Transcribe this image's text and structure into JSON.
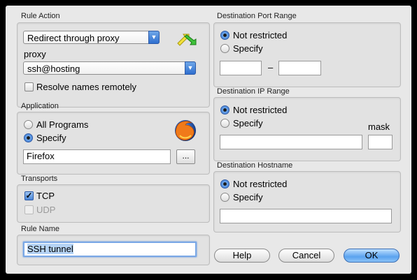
{
  "rule_action": {
    "group_title": "Rule Action",
    "action_value": "Redirect through proxy",
    "proxy_label": "proxy",
    "proxy_value": "ssh@hosting",
    "resolve_label": "Resolve names remotely",
    "icon": "yellow-green-arrows-icon"
  },
  "application": {
    "group_title": "Application",
    "all_programs_label": "All Programs",
    "specify_label": "Specify",
    "selected": "Specify",
    "program_value": "Firefox",
    "browse_label": "...",
    "icon": "firefox-icon"
  },
  "transports": {
    "group_title": "Transports",
    "tcp_label": "TCP",
    "tcp_checked": true,
    "udp_label": "UDP",
    "udp_checked": false
  },
  "rule_name": {
    "group_title": "Rule Name",
    "value": "SSH tunnel"
  },
  "dest_port": {
    "group_title": "Destination Port Range",
    "not_restricted_label": "Not restricted",
    "specify_label": "Specify",
    "selected": "Not restricted",
    "from_value": "",
    "separator": "–",
    "to_value": ""
  },
  "dest_ip": {
    "group_title": "Destination IP Range",
    "not_restricted_label": "Not restricted",
    "specify_label": "Specify",
    "selected": "Not restricted",
    "mask_label": "mask",
    "ip_value": "",
    "mask_value": ""
  },
  "dest_host": {
    "group_title": "Destination Hostname",
    "not_restricted_label": "Not restricted",
    "specify_label": "Specify",
    "selected": "Not restricted",
    "host_value": ""
  },
  "buttons": {
    "help": "Help",
    "cancel": "Cancel",
    "ok": "OK"
  },
  "colors": {
    "accent": "#3a78d4",
    "dialog_bg": "#e8e8e8",
    "frame": "#000000"
  }
}
